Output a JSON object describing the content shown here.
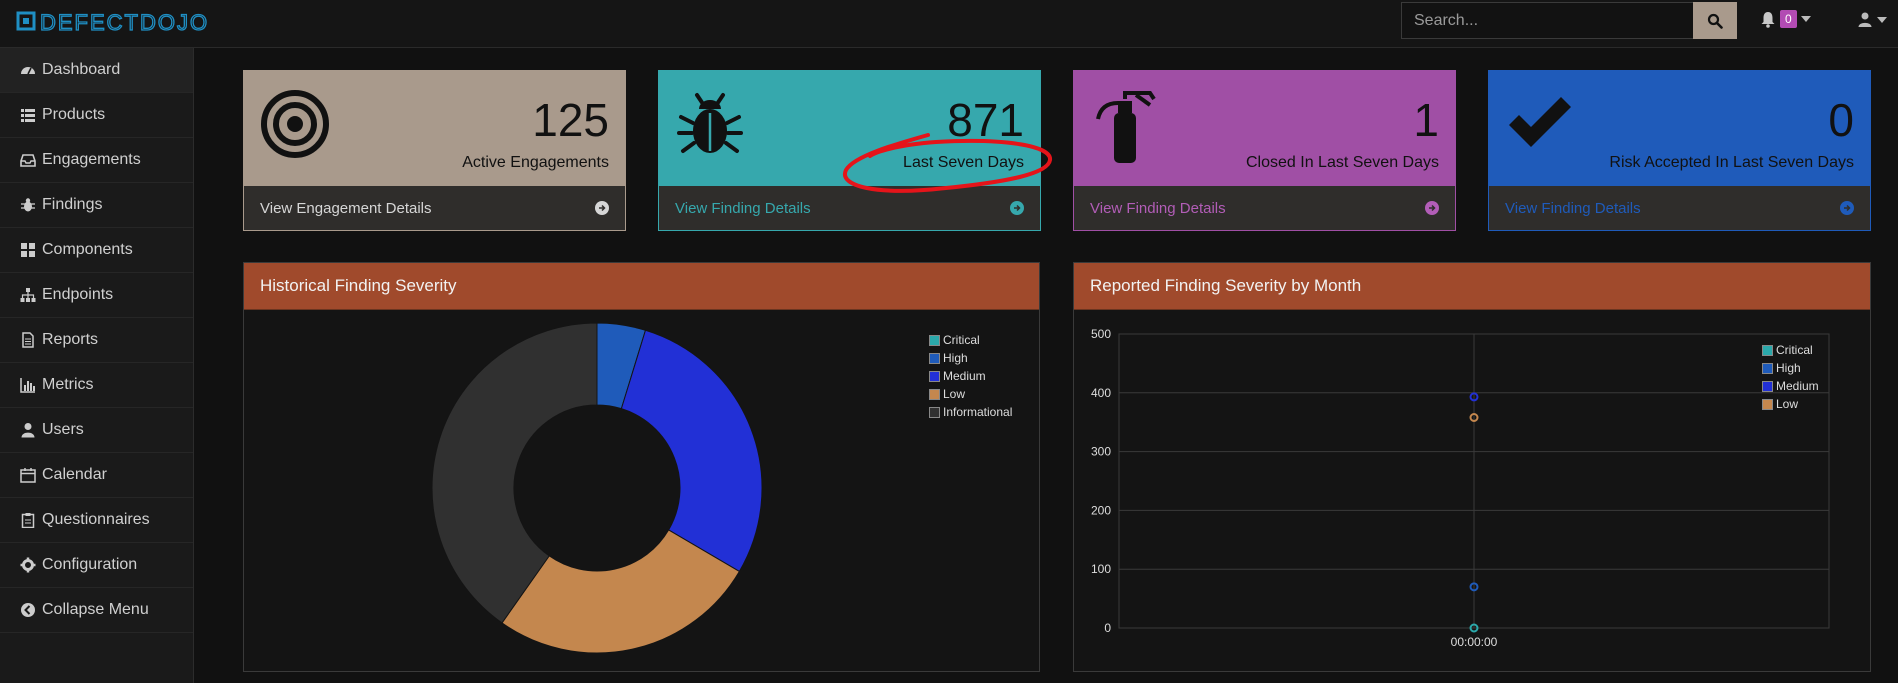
{
  "app": {
    "logo_text": "DEFECTDOJO"
  },
  "header": {
    "search_placeholder": "Search...",
    "notification_count": "0"
  },
  "sidebar": {
    "items": [
      {
        "label": "Dashboard",
        "icon": "dashboard-icon"
      },
      {
        "label": "Products",
        "icon": "list-icon"
      },
      {
        "label": "Engagements",
        "icon": "inbox-icon"
      },
      {
        "label": "Findings",
        "icon": "bug-icon"
      },
      {
        "label": "Components",
        "icon": "components-icon"
      },
      {
        "label": "Endpoints",
        "icon": "sitemap-icon"
      },
      {
        "label": "Reports",
        "icon": "file-icon"
      },
      {
        "label": "Metrics",
        "icon": "bar-chart-icon"
      },
      {
        "label": "Users",
        "icon": "user-icon"
      },
      {
        "label": "Calendar",
        "icon": "calendar-icon"
      },
      {
        "label": "Questionnaires",
        "icon": "clipboard-icon"
      },
      {
        "label": "Configuration",
        "icon": "gear-icon"
      },
      {
        "label": "Collapse Menu",
        "icon": "collapse-icon"
      }
    ]
  },
  "cards": [
    {
      "value": "125",
      "label": "Active Engagements",
      "link": "View Engagement Details",
      "color": "#a99a8c",
      "icon": "bullseye-icon"
    },
    {
      "value": "871",
      "label": "Last Seven Days",
      "link": "View Finding Details",
      "color": "#36a8ad",
      "icon": "bug-icon"
    },
    {
      "value": "1",
      "label": "Closed In Last Seven Days",
      "link": "View Finding Details",
      "color": "#a04fa5",
      "icon": "fire-extinguisher-icon"
    },
    {
      "value": "0",
      "label": "Risk Accepted In Last Seven Days",
      "link": "View Finding Details",
      "color": "#1f5bba",
      "icon": "check-icon"
    }
  ],
  "panels": {
    "historical_title": "Historical Finding Severity",
    "monthly_title": "Reported Finding Severity by Month"
  },
  "chart_data": [
    {
      "type": "pie",
      "title": "Historical Finding Severity",
      "categories": [
        "Critical",
        "High",
        "Medium",
        "Low",
        "Informational"
      ],
      "values": [
        0,
        44,
        266,
        244,
        373
      ],
      "colors": [
        "#2ba8aa",
        "#1f5bba",
        "#2230d6",
        "#c4874e",
        "#303030"
      ],
      "legend": "top-right"
    },
    {
      "type": "line",
      "title": "Reported Finding Severity by Month",
      "x": [
        "00:00:00"
      ],
      "series": [
        {
          "name": "Critical",
          "values": [
            0
          ],
          "color": "#2ba8aa"
        },
        {
          "name": "High",
          "values": [
            70
          ],
          "color": "#1f5bba"
        },
        {
          "name": "Medium",
          "values": [
            393
          ],
          "color": "#2230d6"
        },
        {
          "name": "Low",
          "values": [
            358
          ],
          "color": "#c4874e"
        }
      ],
      "ylim": [
        0,
        500
      ],
      "yticks": [
        "0",
        "100",
        "200",
        "300",
        "400",
        "500"
      ],
      "grid": true,
      "legend": "top-right"
    }
  ]
}
